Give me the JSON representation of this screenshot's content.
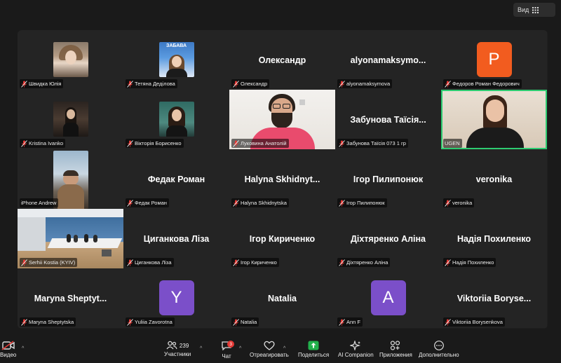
{
  "header": {
    "view_label": "Вид"
  },
  "tiles": {
    "t1": {
      "caption": "Швидка Юлія"
    },
    "t2": {
      "caption": "Тетяна Деділова",
      "logo_text": "ЗАБАВА"
    },
    "t3": {
      "name": "Олександр",
      "caption": "Олександр"
    },
    "t4": {
      "name": "alyonamaksymo...",
      "caption": "alyonamaksymova"
    },
    "t5": {
      "avatar_letter": "P",
      "caption": "Федоров Роман Федорович",
      "color": "#f25c1f"
    },
    "t6": {
      "caption": "Kristina Ivanko"
    },
    "t7": {
      "caption": "Вікторія Борисенко"
    },
    "t8": {
      "caption": "Луковина Анатолій"
    },
    "t9": {
      "name": "Забунова Таїсія...",
      "caption": "Забунова Таїсія 073 1 гр"
    },
    "t10": {
      "caption": "UGEN"
    },
    "t11": {
      "caption": "iPhone Andrew"
    },
    "t12": {
      "name": "Федак Роман",
      "caption": "Федак Роман"
    },
    "t13": {
      "name": "Halyna Skhidnyt...",
      "caption": "Halyna Skhidnytska"
    },
    "t14": {
      "name": "Ігор Пилипонюк",
      "caption": "Ігор Пилипонюк"
    },
    "t15": {
      "name": "veronika",
      "caption": "veronika"
    },
    "t16": {
      "caption": "Serhii Kostia (KYIV)"
    },
    "t17": {
      "name": "Циганкова Ліза",
      "caption": "Циганкова Ліза"
    },
    "t18": {
      "name": "Ігор Кириченко",
      "caption": "Ігор Кириченко"
    },
    "t19": {
      "name": "Діхтяренко Аліна",
      "caption": "Діхтяренко Аліна"
    },
    "t20": {
      "name": "Надія Похиленко",
      "caption": "Надія Похиленко"
    },
    "t21": {
      "name": "Maryna Sheptyt...",
      "caption": "Maryna Sheptytska"
    },
    "t22": {
      "avatar_letter": "Y",
      "caption": "Yuliia Zavorotna",
      "color": "#7b4fc9"
    },
    "t23": {
      "name": "Natalia",
      "caption": "Natalia"
    },
    "t24": {
      "avatar_letter": "A",
      "caption": "Ann F",
      "color": "#7b4fc9"
    },
    "t25": {
      "name": "Viktoriia Boryse...",
      "caption": "Viktoriia Borysenkova"
    }
  },
  "toolbar": {
    "video_label": "Видео",
    "participants_label": "Участники",
    "participants_count": "239",
    "chat_label": "Чат",
    "chat_badge": "3",
    "react_label": "Отреагировать",
    "share_label": "Поделиться",
    "ai_label": "AI Companion",
    "apps_label": "Приложения",
    "more_label": "Дополнительно"
  },
  "colors": {
    "active_speaker": "#2ecc71",
    "share_green": "#22b14c",
    "muted_red": "#e53935"
  }
}
